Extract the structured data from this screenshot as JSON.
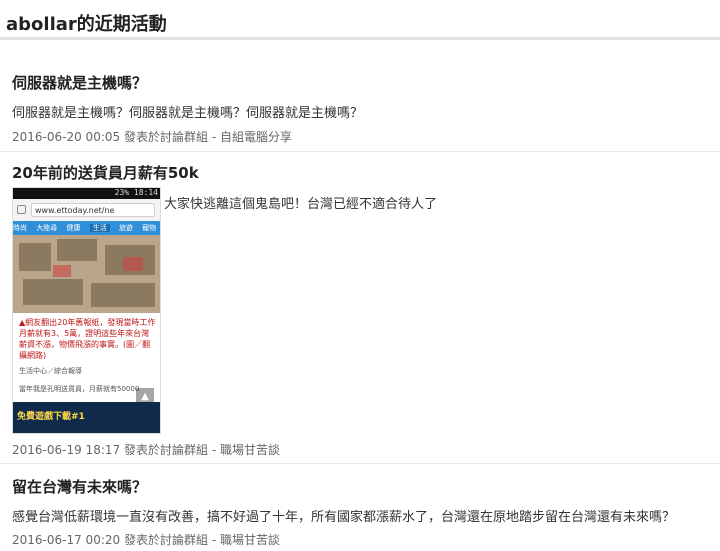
{
  "page": {
    "title": "abollar的近期活動"
  },
  "posts": [
    {
      "title": "伺服器就是主機嗎？",
      "body": "伺服器就是主機嗎？伺服器就是主機嗎？伺服器就是主機嗎？",
      "time": "2016-06-20 00:05",
      "posted_in": "發表於討論群組",
      "group": "自組電腦分享"
    },
    {
      "title": "20年前的送貨員月薪有50k",
      "body": "大家快逃離這個鬼島吧！台灣已經不適合待人了",
      "time": "2016-06-19 18:17",
      "posted_in": "發表於討論群組",
      "group": "職場甘苦談",
      "thumbnail": {
        "status": "23%  18:14",
        "url": "www.ettoday.net/ne",
        "nav": [
          "時尚",
          "大陸尋",
          "健康",
          "生活",
          "旅遊",
          "寵物"
        ],
        "caption": "▲網友翻出20年舊報紙，發現當時工作月薪就有3、5萬，證明這些年來台灣薪資不漲，物價飛漲的事實。(圖／翻攝網路)",
        "credit": "生活中心／綜合報導",
        "snippet": "當年我是孔明送貨員，月薪就有50000",
        "ad": "免費遊戲下載#1"
      }
    },
    {
      "title": "留在台灣有未來嗎？",
      "body": "感覺台灣低薪環境一直沒有改善，搞不好過了十年，所有國家都漲薪水了，台灣還在原地踏步留在台灣還有未來嗎？",
      "time": "2016-06-17 00:20",
      "posted_in": "發表於討論群組",
      "group": "職場甘苦談"
    }
  ],
  "meta_separator": "-"
}
